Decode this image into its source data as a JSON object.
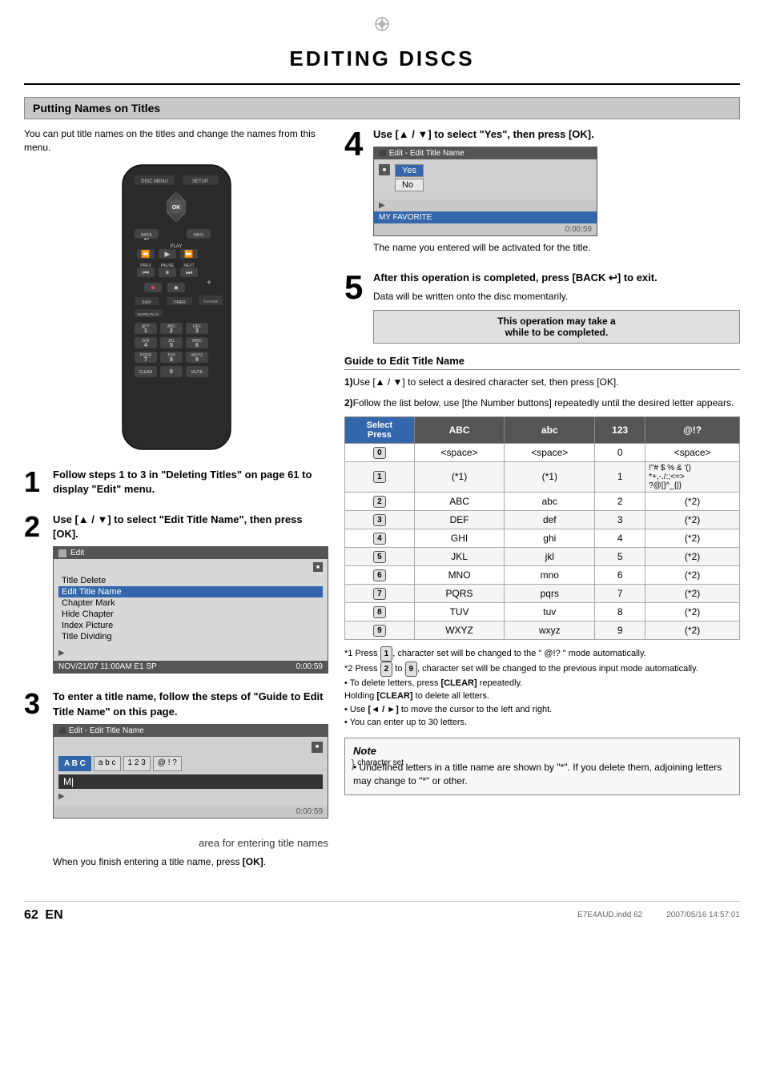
{
  "page": {
    "title": "EDITING DISCS",
    "page_number": "62",
    "lang": "EN",
    "footer_code": "E7E4AUD.indd  62",
    "footer_date": "2007/05/16  14:57:01"
  },
  "section": {
    "title": "Putting Names on Titles",
    "intro": "You can put title names on the titles and change the names from this menu."
  },
  "steps": [
    {
      "number": "1",
      "text": "Follow steps 1 to 3 in \"Deleting Titles\" on page 61 to display \"Edit\" menu."
    },
    {
      "number": "2",
      "heading": "Use [▲ / ▼] to select \"Edit Title Name\", then press [OK].",
      "screen": {
        "header": "Edit",
        "items": [
          "Title Delete",
          "Edit Title Name",
          "Chapter Mark",
          "Hide Chapter",
          "Index Picture",
          "Title Dividing"
        ],
        "selected_index": 1,
        "footer_left": "NOV/21/07 11:00AM  E1 SP",
        "footer_right": "0:00:59"
      }
    },
    {
      "number": "3",
      "heading": "To enter a title name, follow the steps of \"Guide to Edit Title Name\" on this page.",
      "screen": {
        "header": "Edit - Edit Title Name",
        "char_sets": [
          "ABC",
          "abc",
          "123",
          "@!?"
        ],
        "active_char_set": 0,
        "input_value": "M|",
        "footer_right": "0:00:59"
      },
      "area_label": "area for entering title names",
      "char_set_label": "character set",
      "caption": "When you finish entering a title name, press [OK]."
    },
    {
      "number": "4",
      "heading": "Use [▲ / ▼] to select \"Yes\", then press [OK].",
      "screen": {
        "header": "Edit - Edit Title Name",
        "options": [
          "Yes",
          "No"
        ],
        "selected_option": 0,
        "myfav_label": "MY FAVORITE",
        "time": "0:00:59"
      },
      "caption": "The name you entered will be activated for the title."
    },
    {
      "number": "5",
      "heading": "After this operation is completed, press [BACK ↩] to exit.",
      "text": "Data will be written onto the disc momentarily.",
      "warning": "This operation may take a\nwhile to be completed."
    }
  ],
  "guide": {
    "title": "Guide to Edit Title Name",
    "instructions": [
      "1)Use [▲ / ▼] to select a desired character set, then press [OK].",
      "2)Follow the list below, use [the Number buttons] repeatedly until the desired letter appears."
    ],
    "table": {
      "headers": [
        "Select\nPress",
        "ABC",
        "abc",
        "123",
        "@!?"
      ],
      "rows": [
        {
          "btn": "0",
          "abc": "<space>",
          "abc_lower": "<space>",
          "n123": "0",
          "special": "<space>"
        },
        {
          "btn": "1",
          "abc": "(*1)",
          "abc_lower": "(*1)",
          "n123": "1",
          "special": "!\"# $ % & '()\n*+,-./:;<=>?\n@[]^_{|}"
        },
        {
          "btn": "2",
          "abc": "ABC",
          "abc_lower": "abc",
          "n123": "2",
          "special": "(*2)"
        },
        {
          "btn": "3",
          "abc": "DEF",
          "abc_lower": "def",
          "n123": "3",
          "special": "(*2)"
        },
        {
          "btn": "4",
          "abc": "GHI",
          "abc_lower": "ghi",
          "n123": "4",
          "special": "(*2)"
        },
        {
          "btn": "5",
          "abc": "JKL",
          "abc_lower": "jkl",
          "n123": "5",
          "special": "(*2)"
        },
        {
          "btn": "6",
          "abc": "MNO",
          "abc_lower": "mno",
          "n123": "6",
          "special": "(*2)"
        },
        {
          "btn": "7",
          "abc": "PQRS",
          "abc_lower": "pqrs",
          "n123": "7",
          "special": "(*2)"
        },
        {
          "btn": "8",
          "abc": "TUV",
          "abc_lower": "tuv",
          "n123": "8",
          "special": "(*2)"
        },
        {
          "btn": "9",
          "abc": "WXYZ",
          "abc_lower": "wxyz",
          "n123": "9",
          "special": "(*2)"
        }
      ]
    },
    "footnotes": [
      "*1 Press [1], character set will be changed to the \" @!? \" mode automatically.",
      "*2 Press [2] to [9], character set will be changed to the previous input mode automatically.",
      "• To delete letters, press [CLEAR] repeatedly. Holding [CLEAR] to delete all letters.",
      "• Use [◄ / ►] to move the cursor to the left and right.",
      "• You can enter up to 30 letters."
    ],
    "note": {
      "title": "Note",
      "text": "• Undefined letters in a title name are shown by \"*\". If you delete them, adjoining letters may change to \"*\" or other."
    }
  }
}
